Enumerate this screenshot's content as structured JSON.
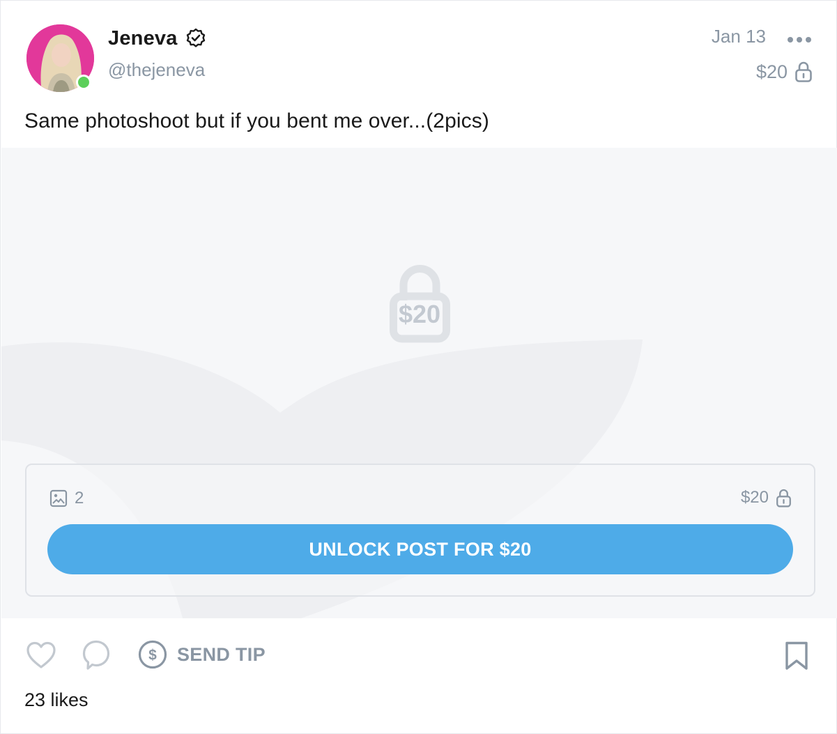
{
  "author": {
    "display_name": "Jeneva",
    "handle": "@thejeneva",
    "verified_icon": "verified-badge-icon",
    "online": true,
    "avatar_bg": "#e2389a"
  },
  "post": {
    "date": "Jan 13",
    "price": "$20",
    "caption": "Same photoshoot but if you bent me over...(2pics)",
    "more_icon": "more-dots-icon"
  },
  "locked_media": {
    "overlay_price": "$20",
    "media_count": "2",
    "box_price": "$20",
    "unlock_label": "UNLOCK POST FOR $20",
    "accent_color": "#4eabe8"
  },
  "actions": {
    "like_icon": "heart-icon",
    "comment_icon": "comment-icon",
    "tip_label": "SEND TIP",
    "bookmark_icon": "bookmark-icon"
  },
  "likes": "23 likes"
}
